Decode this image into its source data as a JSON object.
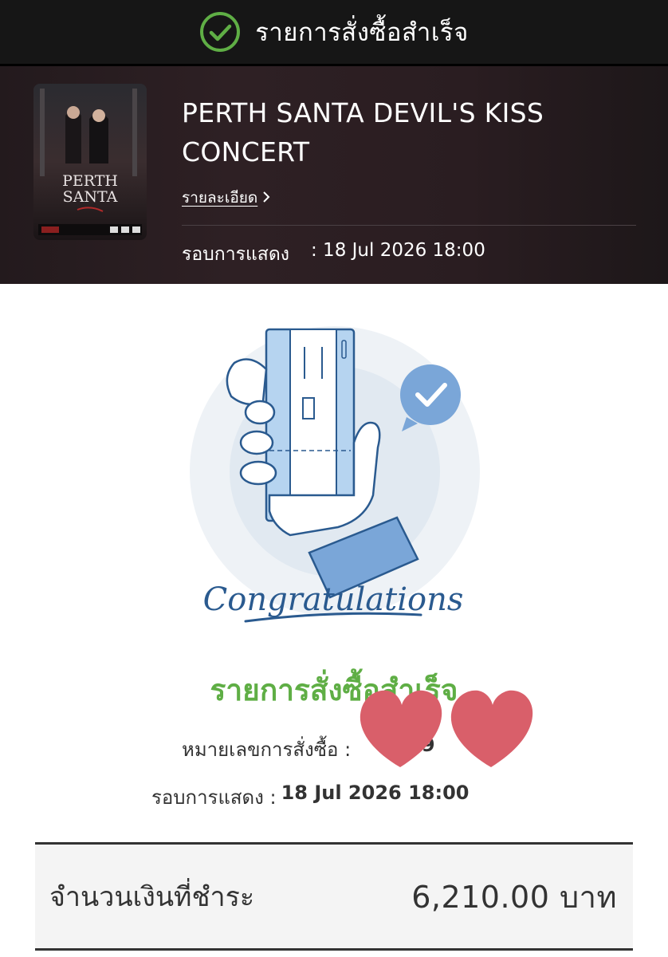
{
  "header": {
    "status_title": "รายการสั่งซื้อสำเร็จ",
    "status_icon": "check-circle-icon",
    "accent_color": "#5fae45"
  },
  "event": {
    "name": "PERTH SANTA DEVIL'S KISS CONCERT",
    "details_link": "รายละเอียด",
    "showtime_label": "รอบการแสดง",
    "showtime_value": ": 18 Jul 2026 18:00",
    "poster_title": "PERTH SANTA"
  },
  "illustration": {
    "caption": "Congratulations"
  },
  "confirmation": {
    "title": "รายการสั่งซื้อสำเร็จ",
    "order_label": "หมายเลขการสั่งซื้อ :",
    "order_value_visible": "69",
    "show_label": "รอบการแสดง :",
    "show_value": "18 Jul 2026 18:00"
  },
  "payment": {
    "label": "จำนวนเงินที่ชำระ",
    "amount": "6,210.00 บาท"
  }
}
